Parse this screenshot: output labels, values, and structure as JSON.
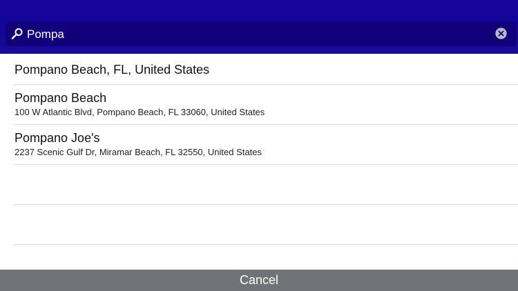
{
  "search": {
    "query": "Pompa"
  },
  "results": [
    {
      "title": "Pompano Beach, FL, United States",
      "subtitle": ""
    },
    {
      "title": "Pompano Beach",
      "subtitle": "100 W Atlantic Blvd, Pompano Beach, FL  33060, United States"
    },
    {
      "title": "Pompano Joe's",
      "subtitle": "2237 Scenic Gulf Dr, Miramar Beach, FL  32550, United States"
    }
  ],
  "footer": {
    "cancel_label": "Cancel"
  },
  "colors": {
    "header": "#18059c",
    "search_field": "#11007a",
    "cancel_bar": "#6f7276"
  },
  "icons": {
    "search": "search-icon",
    "clear": "clear-icon"
  }
}
